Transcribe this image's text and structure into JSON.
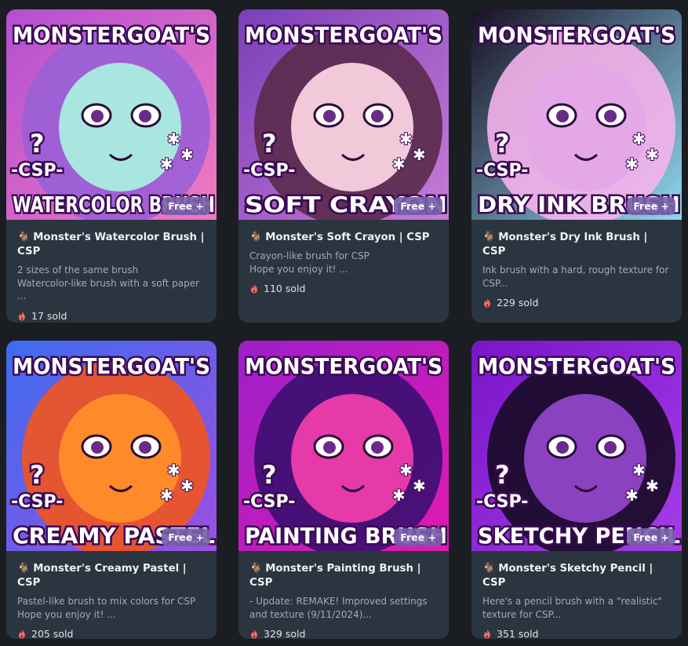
{
  "products": [
    {
      "art_top": "MONSTERGOAT'S",
      "art_bottom": "WATERCOLOR BRUSH",
      "art_side": "-CSP-",
      "badge": "Free +",
      "title": "Monster's Watercolor Brush | CSP",
      "description": "2 sizes of the same brush\nWatercolor-like brush with a soft paper ...",
      "sold": "17 sold",
      "colors": {
        "bg1": "#b44fd1",
        "bg2": "#f07ac0",
        "skin": "#a9e6e0",
        "hair": "#9a5fd6"
      }
    },
    {
      "art_top": "MONSTERGOAT'S",
      "art_bottom": "SOFT CRAYON",
      "art_side": "-CSP-",
      "badge": "Free +",
      "title": "Monster's Soft Crayon | CSP",
      "description": "Crayon-like brush for CSP\nHope you enjoy it! ...",
      "sold": "110 sold",
      "colors": {
        "bg1": "#7a3fb8",
        "bg2": "#c77bd6",
        "skin": "#f2c9d8",
        "hair": "#5a2a4a"
      }
    },
    {
      "art_top": "MONSTERGOAT'S",
      "art_bottom": "DRY INK BRUSH",
      "art_side": "-CSP-",
      "badge": "Free +",
      "title": "Monster's Dry Ink Brush | CSP",
      "description": "Ink brush with a hard, rough texture for\nCSP...",
      "sold": "229 sold",
      "colors": {
        "bg1": "#1a0f24",
        "bg2": "#8fd9f0",
        "skin": "#e4a8e8",
        "hair": "#f5b4ec"
      }
    },
    {
      "art_top": "MONSTERGOAT'S",
      "art_bottom": "CREAMY PASTEL",
      "art_side": "-CSP-",
      "badge": "Free +",
      "title": "Monster's Creamy Pastel | CSP",
      "description": "Pastel-like brush to mix colors for CSP\nHope you enjoy it! ...",
      "sold": "205 sold",
      "colors": {
        "bg1": "#3d6cf0",
        "bg2": "#9b4fe0",
        "skin": "#ff8a2a",
        "hair": "#f2541e"
      }
    },
    {
      "art_top": "MONSTERGOAT'S",
      "art_bottom": "PAINTING BRUSH",
      "art_side": "-CSP-",
      "badge": "Free +",
      "title": "Monster's Painting Brush | CSP",
      "description": "- Update: REMAKE! Improved settings\nand texture (9/11/2024)...",
      "sold": "329 sold",
      "colors": {
        "bg1": "#9c1fc9",
        "bg2": "#e01ab0",
        "skin": "#e63aa8",
        "hair": "#3a1070"
      }
    },
    {
      "art_top": "MONSTERGOAT'S",
      "art_bottom": "SKETCHY PENCIL",
      "art_side": "-CSP-",
      "badge": "Free +",
      "title": "Monster's Sketchy Pencil | CSP",
      "description": "Here's a pencil brush with a \"realistic\"\ntexture for CSP...",
      "sold": "351 sold",
      "colors": {
        "bg1": "#7a15c9",
        "bg2": "#a43de6",
        "skin": "#8a42c0",
        "hair": "#160a24"
      }
    }
  ]
}
